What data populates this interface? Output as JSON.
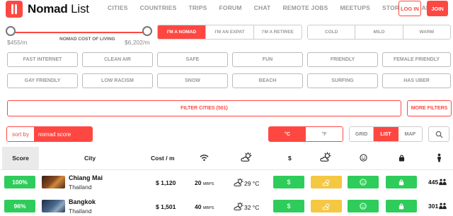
{
  "header": {
    "logo_bold": "Nomad",
    "logo_thin": "List",
    "nav": [
      "CITIES",
      "COUNTRIES",
      "TRIPS",
      "FORUM",
      "CHAT",
      "REMOTE JOBS",
      "MEETUPS",
      "STORIES",
      "ABOUT"
    ],
    "login": "LOG IN",
    "join": "JOIN"
  },
  "cost_slider": {
    "label": "NOMAD COST OF LIVING",
    "min": "$455/m",
    "max": "$6,202/m"
  },
  "persona": {
    "options": [
      "I'M A NOMAD",
      "I'M AN EXPAT",
      "I'M A RETIREE"
    ],
    "selected": "I'M A NOMAD"
  },
  "climate": {
    "options": [
      "COLD",
      "MILD",
      "WARM"
    ]
  },
  "tags": {
    "row1": [
      "FAST INTERNET",
      "CLEAN AIR",
      "SAFE",
      "FUN",
      "FRIENDLY",
      "FEMALE FRIENDLY"
    ],
    "row2": [
      "GAY FRIENDLY",
      "LOW RACISM",
      "SNOW",
      "BEACH",
      "SURFING",
      "HAS UBER"
    ]
  },
  "filter_button": "FILTER CITIES (501)",
  "more_filters": "MORE FILTERS",
  "sort": {
    "label": "sort by",
    "value": "nomad score"
  },
  "units": {
    "options": [
      "°C",
      "°F"
    ],
    "selected": "°C"
  },
  "views": {
    "options": [
      "GRID",
      "LIST",
      "MAP"
    ],
    "selected": "LIST"
  },
  "table": {
    "headers": {
      "score": "Score",
      "city": "City",
      "cost": "Cost / m",
      "price": "$"
    },
    "rows": [
      {
        "score": "100%",
        "city": "Chiang Mai",
        "country": "Thailand",
        "cost": "$ 1,120",
        "internet": "20",
        "internet_unit": "MBPS",
        "temp": "29 °C",
        "price_symbol": "$",
        "people": "445",
        "thumb_color": "#6b3a1f"
      },
      {
        "score": "96%",
        "city": "Bangkok",
        "country": "Thailand",
        "cost": "$ 1,501",
        "internet": "40",
        "internet_unit": "MBPS",
        "temp": "32 °C",
        "price_symbol": "$",
        "people": "301",
        "thumb_color": "#34506e"
      }
    ]
  },
  "colors": {
    "brand": "#ff4742",
    "good": "#2ecc5a",
    "ok": "#f5c842"
  }
}
